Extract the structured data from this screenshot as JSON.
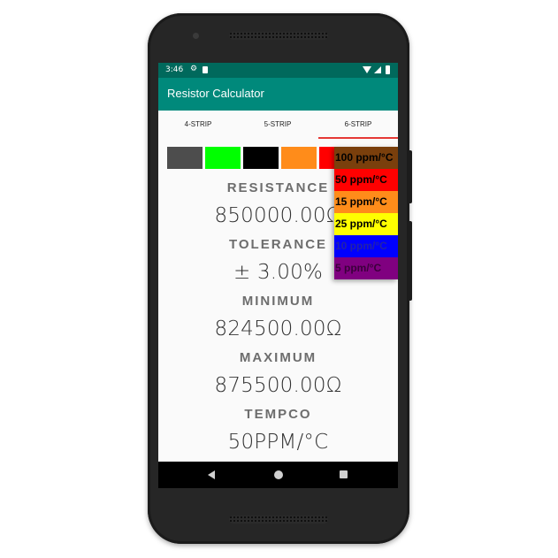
{
  "status_bar": {
    "time": "3:46",
    "icons": [
      "settings-icon",
      "sd-card-icon",
      "wifi-icon",
      "signal-icon",
      "battery-icon"
    ]
  },
  "app_bar": {
    "title": "Resistor Calculator"
  },
  "tabs": [
    {
      "label": "4-STRIP",
      "active": false
    },
    {
      "label": "5-STRIP",
      "active": false
    },
    {
      "label": "6-STRIP",
      "active": true
    }
  ],
  "colors": {
    "status_bar": "#00695c",
    "app_bar": "#00897b",
    "tab_indicator": "#e53935"
  },
  "bands": [
    {
      "name": "gray",
      "color": "#4d4d4d"
    },
    {
      "name": "green",
      "color": "#00ff00"
    },
    {
      "name": "black",
      "color": "#000000"
    },
    {
      "name": "orange",
      "color": "#ff8c1a"
    },
    {
      "name": "red",
      "color": "#ff0000"
    }
  ],
  "results": {
    "resistance_label": "RESISTANCE",
    "resistance_value": "850000.00Ω",
    "tolerance_label": "TOLERANCE",
    "tolerance_value": "± 3.00%",
    "minimum_label": "MINIMUM",
    "minimum_value": "824500.00Ω",
    "maximum_label": "MAXIMUM",
    "maximum_value": "875500.00Ω",
    "tempco_label": "TEMPCO",
    "tempco_value": "50PPM/°C"
  },
  "tempco_dropdown": {
    "options": [
      {
        "label": "100 ppm/°C",
        "color": "#7a3f0c",
        "text_color": "#000000"
      },
      {
        "label": "50 ppm/°C",
        "color": "#ff0000",
        "text_color": "#000000"
      },
      {
        "label": "15 ppm/°C",
        "color": "#ff8c1a",
        "text_color": "#000000"
      },
      {
        "label": "25 ppm/°C",
        "color": "#ffff00",
        "text_color": "#000000"
      },
      {
        "label": "10 ppm/°C",
        "color": "#0000ff",
        "text_color": "#2222aa"
      },
      {
        "label": "5 ppm/°C",
        "color": "#800080",
        "text_color": "#3a003a"
      }
    ]
  },
  "nav_bar": {
    "icons": [
      "back-icon",
      "home-icon",
      "recent-apps-icon"
    ]
  }
}
